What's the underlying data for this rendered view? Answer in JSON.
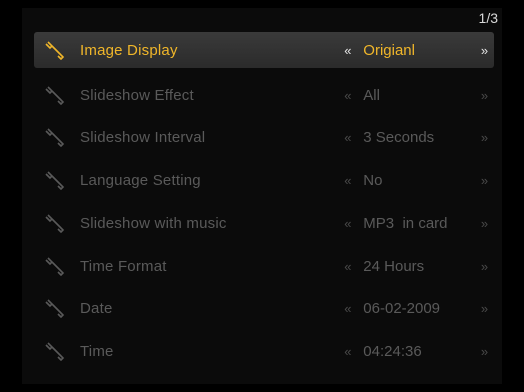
{
  "page_indicator": "1/3",
  "icons": {
    "row_icon": "wrench-icon",
    "left_arrow": "double-chevron-left-icon",
    "right_arrow": "double-chevron-right-icon"
  },
  "colors": {
    "selected_text": "#f0b62a",
    "dim_text": "#5a5a5a",
    "highlight_bg": "#333333"
  },
  "menu": {
    "items": [
      {
        "label": "Image Display",
        "value": "Origianl",
        "selected": true
      },
      {
        "label": "Slideshow Effect",
        "value": "All",
        "selected": false
      },
      {
        "label": "Slideshow Interval",
        "value": "3 Seconds",
        "selected": false
      },
      {
        "label": "Language Setting",
        "value": "No",
        "selected": false
      },
      {
        "label": "Slideshow with music",
        "value": "MP3  in card",
        "selected": false
      },
      {
        "label": "Time Format",
        "value": "24 Hours",
        "selected": false
      },
      {
        "label": "Date",
        "value": "06-02-2009",
        "selected": false
      },
      {
        "label": "Time",
        "value": "04:24:36",
        "selected": false
      }
    ],
    "arrow_left": "«",
    "arrow_right": "»"
  }
}
